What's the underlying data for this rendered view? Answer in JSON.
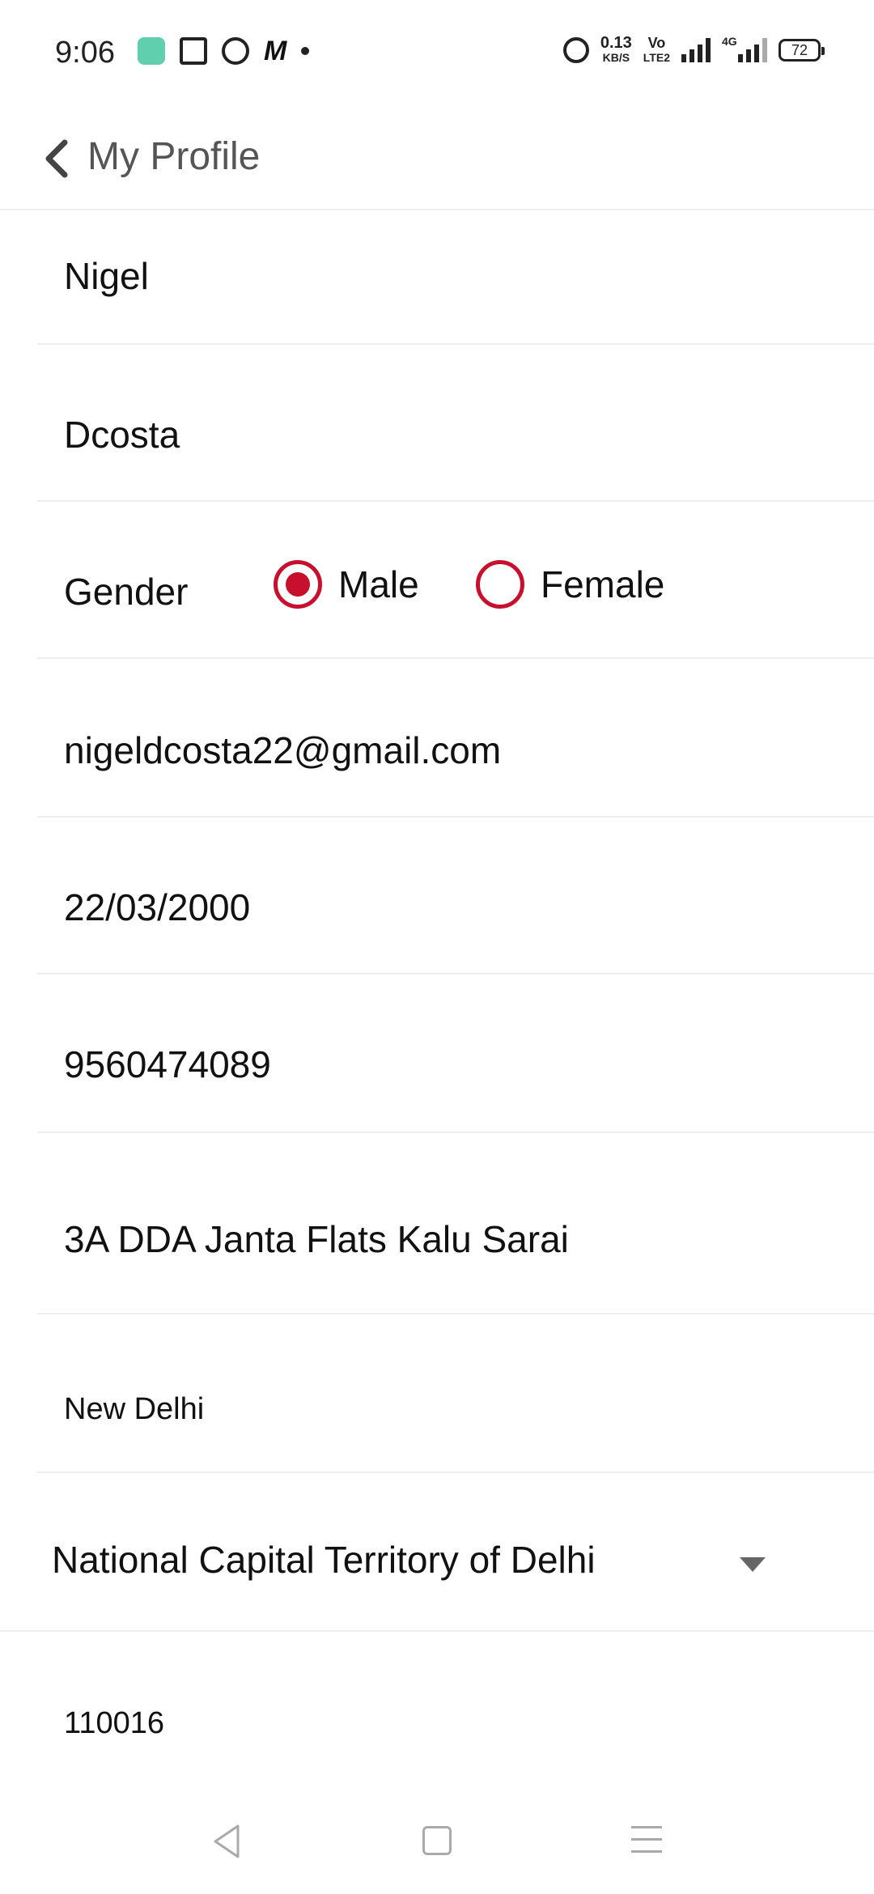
{
  "status_bar": {
    "time": "9:06",
    "speed_value": "0.13",
    "speed_unit": "KB/S",
    "volte_top": "Vo",
    "volte_bottom": "LTE2",
    "network": "4G",
    "battery": "72"
  },
  "app_bar": {
    "title": "My Profile"
  },
  "profile": {
    "first_name": "Nigel",
    "last_name": "Dcosta",
    "gender_label": "Gender",
    "gender_options": [
      "Male",
      "Female"
    ],
    "gender_selected": "Male",
    "email": "nigeldcosta22@gmail.com",
    "dob": "22/03/2000",
    "phone": "9560474089",
    "address": "3A DDA Janta Flats Kalu Sarai",
    "city": "New Delhi",
    "state": "National Capital Territory of Delhi",
    "pincode": "110016"
  },
  "colors": {
    "accent": "#c8102e",
    "divider": "#eeeeee",
    "title_text": "#555555"
  }
}
